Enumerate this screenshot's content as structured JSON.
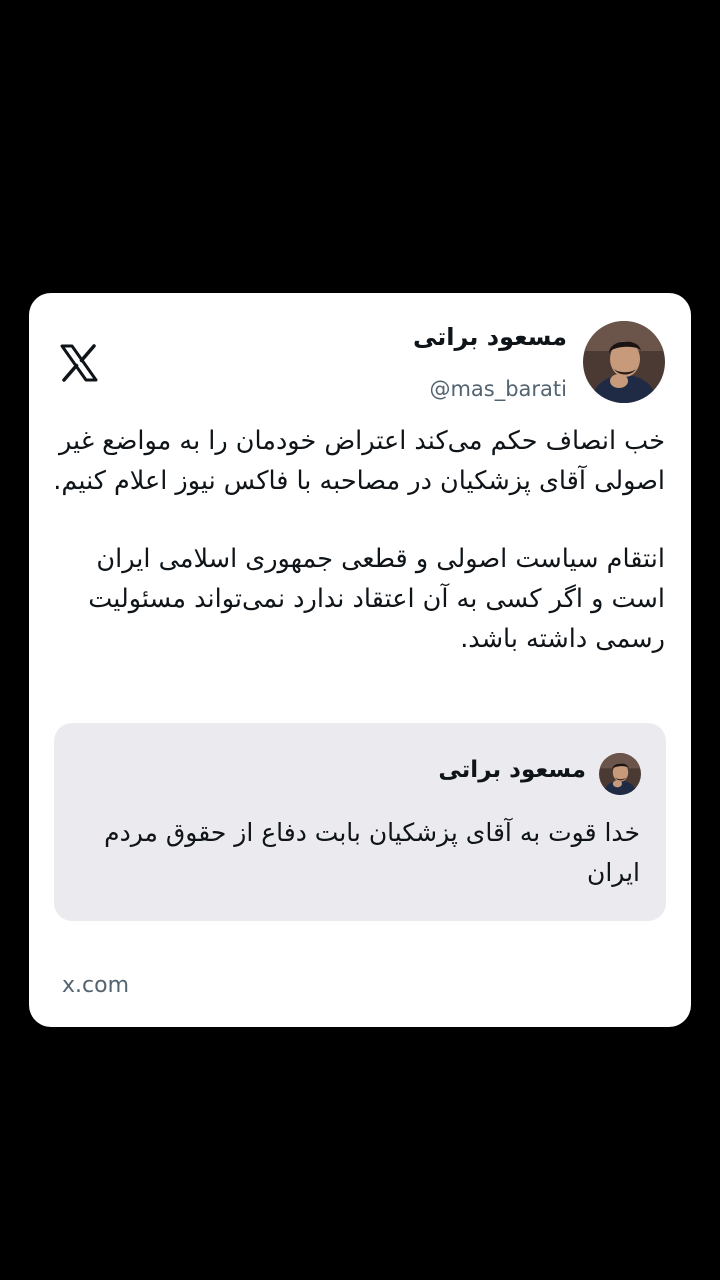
{
  "post": {
    "author_name": "مسعود براتی",
    "author_handle": "@mas_barati",
    "paragraphs": [
      "خب انصاف حکم می‌کند اعتراض خودمان را به مواضع غیر اصولی آقای پزشکیان در مصاحبه با فاکس نیوز اعلام کنیم.",
      "انتقام سیاست اصولی و قطعی جمهوری اسلامی ایران است و اگر کسی به آن اعتقاد ندارد نمی‌تواند مسئولیت رسمی داشته باشد."
    ]
  },
  "quoted_post": {
    "author_name": "مسعود براتی",
    "text": "خدا قوت به آقای پزشکیان بابت دفاع از حقوق مردم ایران"
  },
  "footer": {
    "domain": "x.com"
  },
  "icons": {
    "brand": "x-logo-icon"
  },
  "colors": {
    "background": "#000000",
    "card": "#ffffff",
    "quote_background": "#ebebef",
    "text_primary": "#0f1419",
    "text_secondary": "#536471"
  }
}
